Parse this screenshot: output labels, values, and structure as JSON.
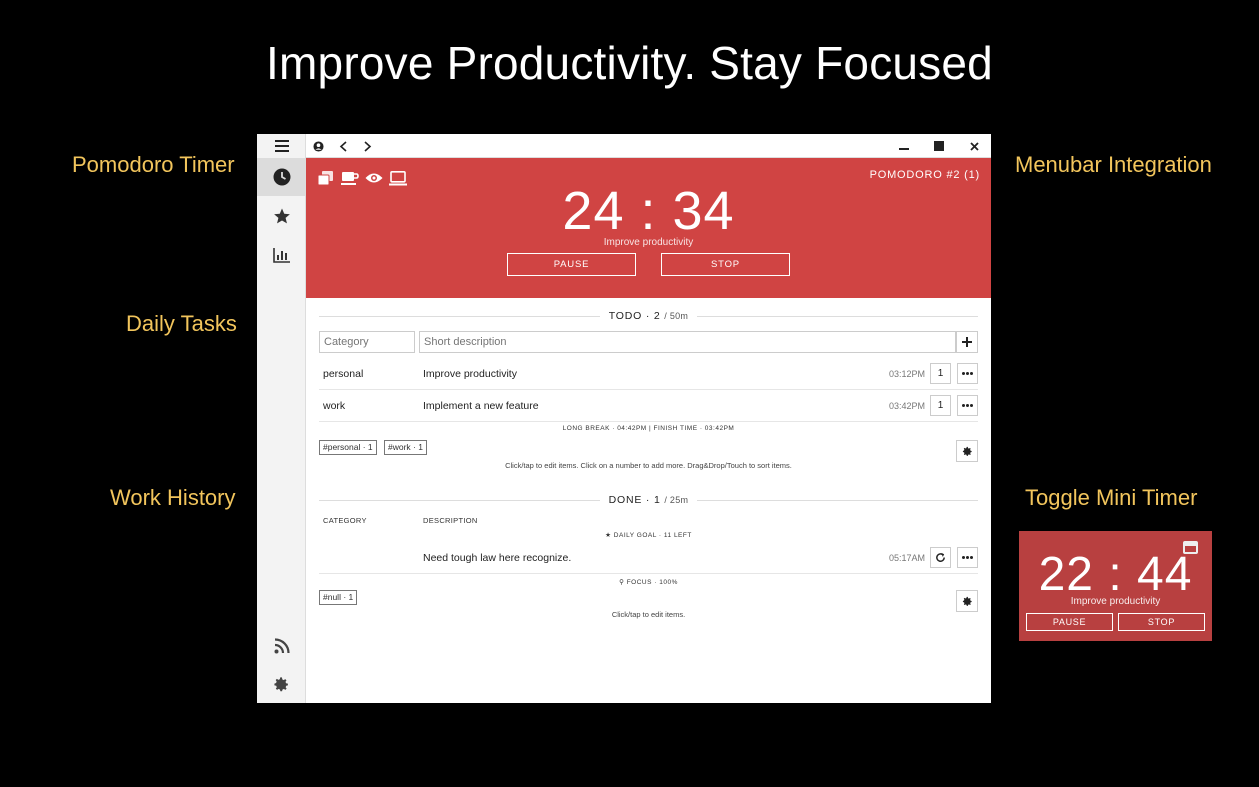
{
  "headline": "Improve Productivity. Stay Focused",
  "callouts": {
    "pomodoro_timer": "Pomodoro Timer",
    "daily_tasks": "Daily Tasks",
    "work_history": "Work History",
    "menubar_integration": "Menubar Integration",
    "toggle_mini_timer": "Toggle Mini Timer"
  },
  "titlebar": {
    "menu_icon": "hamburger-icon",
    "account_icon": "account-icon",
    "back_icon": "chevron-left-icon",
    "forward_icon": "chevron-right-icon",
    "minimize_icon": "minimize-icon",
    "maximize_icon": "maximize-icon",
    "close_icon": "close-icon"
  },
  "sidebar": {
    "items": [
      {
        "name": "timer",
        "icon": "clock-icon",
        "active": true
      },
      {
        "name": "favorites",
        "icon": "star-icon"
      },
      {
        "name": "statistics",
        "icon": "bar-chart-icon"
      },
      {
        "name": "feed",
        "icon": "rss-icon"
      },
      {
        "name": "settings",
        "icon": "gear-icon"
      }
    ]
  },
  "timer": {
    "session_label": "POMODORO #2 (1)",
    "time": "24 : 34",
    "current_task": "Improve productivity",
    "pause_label": "PAUSE",
    "stop_label": "STOP",
    "accent_color": "#d04443",
    "mode_icons": [
      "pomodoro-icon",
      "break-icon",
      "focus-icon",
      "desktop-icon"
    ]
  },
  "todo": {
    "title": "TODO · 2",
    "duration": "/ 50m",
    "category_placeholder": "Category",
    "description_placeholder": "Short description",
    "rows": [
      {
        "category": "personal",
        "description": "Improve productivity",
        "time": "03:12PM",
        "count": "1"
      },
      {
        "category": "work",
        "description": "Implement a new feature",
        "time": "03:42PM",
        "count": "1"
      }
    ],
    "summary": "LONG BREAK · 04:42PM  |  FINISH TIME · 03:42PM",
    "tags": [
      "#personal · 1",
      "#work · 1"
    ],
    "hint": "Click/tap to edit items. Click on a number to add more. Drag&Drop/Touch to sort items."
  },
  "done": {
    "title": "DONE · 1",
    "duration": "/ 25m",
    "column_category": "CATEGORY",
    "column_description": "DESCRIPTION",
    "goal": "DAILY GOAL · 11 LEFT",
    "rows": [
      {
        "category": "",
        "description": "Need tough law here recognize.",
        "time": "05:17AM"
      }
    ],
    "focus": "FOCUS · 100%",
    "tags": [
      "#null · 1"
    ],
    "hint": "Click/tap to edit items."
  },
  "mini_timer": {
    "time": "22 : 44",
    "current_task": "Improve productivity",
    "pause_label": "PAUSE",
    "stop_label": "STOP",
    "bg_color": "#b84040"
  }
}
